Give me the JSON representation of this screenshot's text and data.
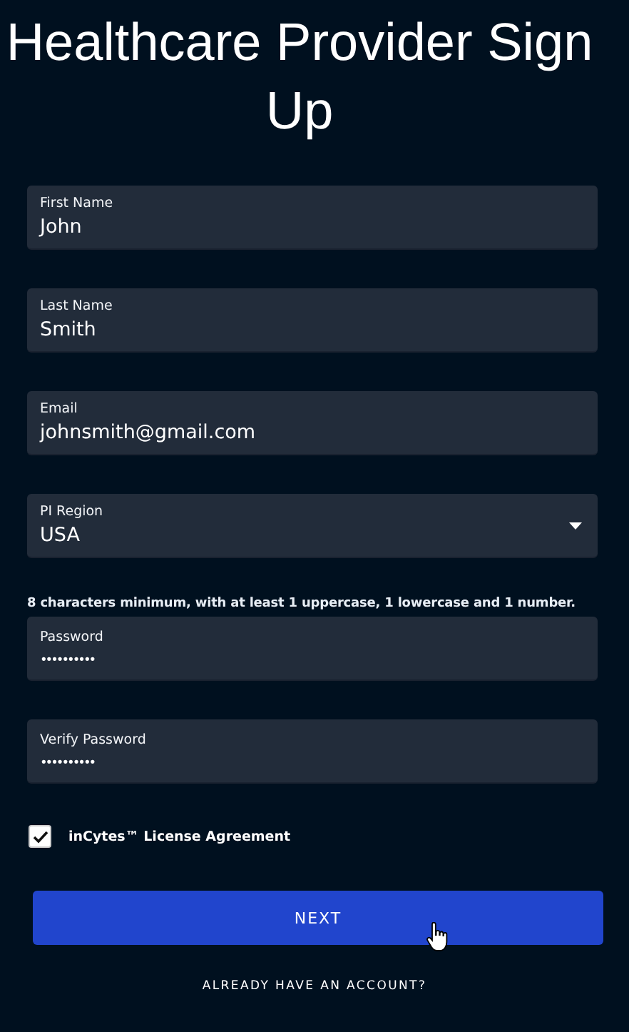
{
  "title": "Healthcare Provider Sign Up",
  "fields": [
    {
      "kind": "text",
      "label": "First Name",
      "value": "John"
    },
    {
      "kind": "text",
      "label": "Last Name",
      "value": "Smith"
    },
    {
      "kind": "text",
      "label": "Email",
      "value": "johnsmith@gmail.com"
    },
    {
      "kind": "select",
      "label": "PI Region",
      "value": "USA"
    },
    {
      "kind": "password",
      "hint": "8 characters minimum, with at least 1 uppercase, 1 lowercase and 1 number.",
      "label": "Password",
      "value": "••••••••••"
    },
    {
      "kind": "password",
      "label": "Verify Password",
      "value": "••••••••••"
    }
  ],
  "agreement": {
    "label": "inCytes™ License Agreement",
    "checked": true
  },
  "next_button": "NEXT",
  "login_link": "ALREADY HAVE AN ACCOUNT?"
}
